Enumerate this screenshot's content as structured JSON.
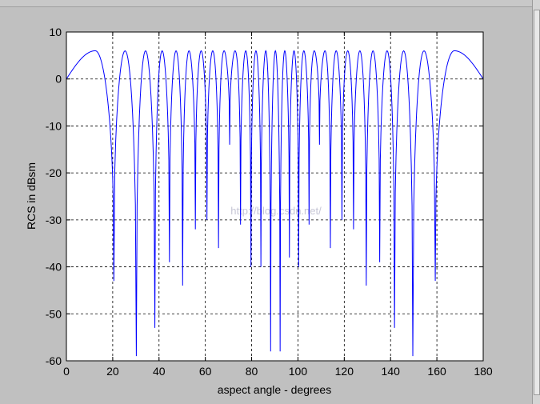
{
  "window": {
    "background": "#c0c0c0"
  },
  "chart_data": {
    "type": "line",
    "title": "",
    "xlabel": "aspect angle - degrees",
    "ylabel": "RCS in dBsm",
    "xlim": [
      0,
      180
    ],
    "ylim": [
      -60,
      10
    ],
    "xticks": [
      "0",
      "20",
      "40",
      "60",
      "80",
      "100",
      "120",
      "140",
      "160",
      "180"
    ],
    "yticks": [
      "10",
      "0",
      "-10",
      "-20",
      "-30",
      "-40",
      "-50",
      "-60"
    ],
    "grid": true,
    "line_color": "#0000ff",
    "series": [
      {
        "x": [
          0,
          12.5,
          25,
          167.5,
          180
        ],
        "y": [
          0,
          6,
          6,
          6,
          0
        ]
      }
    ],
    "nulls": [
      {
        "x": 20.5,
        "y": -43
      },
      {
        "x": 30.2,
        "y": -59
      },
      {
        "x": 38.2,
        "y": -53
      },
      {
        "x": 44.5,
        "y": -39
      },
      {
        "x": 50.2,
        "y": -44
      },
      {
        "x": 55.7,
        "y": -32
      },
      {
        "x": 60.7,
        "y": -30
      },
      {
        "x": 65.7,
        "y": -36
      },
      {
        "x": 70.5,
        "y": -14
      },
      {
        "x": 75.2,
        "y": -31
      },
      {
        "x": 79.7,
        "y": -40
      },
      {
        "x": 84.0,
        "y": -40
      },
      {
        "x": 88.2,
        "y": -58
      },
      {
        "x": 92.3,
        "y": -58
      },
      {
        "x": 96.3,
        "y": -38
      },
      {
        "x": 100.3,
        "y": -40
      },
      {
        "x": 104.8,
        "y": -31
      },
      {
        "x": 109.3,
        "y": -14
      },
      {
        "x": 114.0,
        "y": -36
      },
      {
        "x": 119.0,
        "y": -30
      },
      {
        "x": 124.0,
        "y": -32
      },
      {
        "x": 129.5,
        "y": -44
      },
      {
        "x": 135.3,
        "y": -39
      },
      {
        "x": 141.7,
        "y": -53
      },
      {
        "x": 149.6,
        "y": -59
      },
      {
        "x": 159.3,
        "y": -43
      }
    ],
    "peak_db": 6,
    "watermark": "http://blog.csdn.net/"
  }
}
